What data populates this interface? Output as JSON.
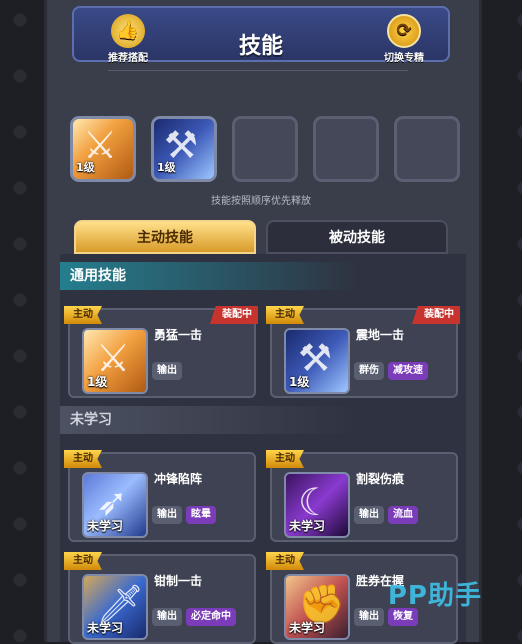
{
  "header": {
    "title": "技能",
    "recommend_label": "推荐搭配",
    "switch_label": "切换专精",
    "recommend_icon": "thumbs-up-icon",
    "switch_icon": "refresh-icon"
  },
  "slots": [
    {
      "level": "1级",
      "icon": "sword-icon"
    },
    {
      "level": "1级",
      "icon": "hammer-icon"
    },
    {
      "level": "",
      "icon": ""
    },
    {
      "level": "",
      "icon": ""
    },
    {
      "level": "",
      "icon": ""
    }
  ],
  "hint": "技能按照顺序优先释放",
  "tabs": {
    "active": "主动技能",
    "inactive": "被动技能"
  },
  "sections": {
    "learned": "通用技能",
    "unlearned": "未学习"
  },
  "common_tag": "主动",
  "equipped_label": "装配中",
  "learned_skills": [
    {
      "name": "勇猛一击",
      "level": "1级",
      "chips": [
        "输出"
      ],
      "icon": "sword-icon"
    },
    {
      "name": "震地一击",
      "level": "1级",
      "chips": [
        "群伤",
        "减攻速"
      ],
      "icon": "hammer-icon"
    }
  ],
  "unlearned_skills": [
    {
      "name": "冲锋陷阵",
      "level": "未学习",
      "chips": [
        "输出",
        "眩晕"
      ],
      "icon": "charge-icon"
    },
    {
      "name": "割裂伤痕",
      "level": "未学习",
      "chips": [
        "输出",
        "流血"
      ],
      "icon": "rend-icon"
    },
    {
      "name": "钳制一击",
      "level": "未学习",
      "chips": [
        "输出",
        "必定命中"
      ],
      "icon": "clamp-icon"
    },
    {
      "name": "胜券在握",
      "level": "未学习",
      "chips": [
        "输出",
        "恢复"
      ],
      "icon": "victory-icon"
    }
  ],
  "watermark": "PP助手",
  "colors": {
    "accent": "#d89b2a",
    "header": "#2b3566",
    "equip": "#c7342e",
    "chip_purple": "#7a3cb8",
    "teal": "#247e8e"
  }
}
